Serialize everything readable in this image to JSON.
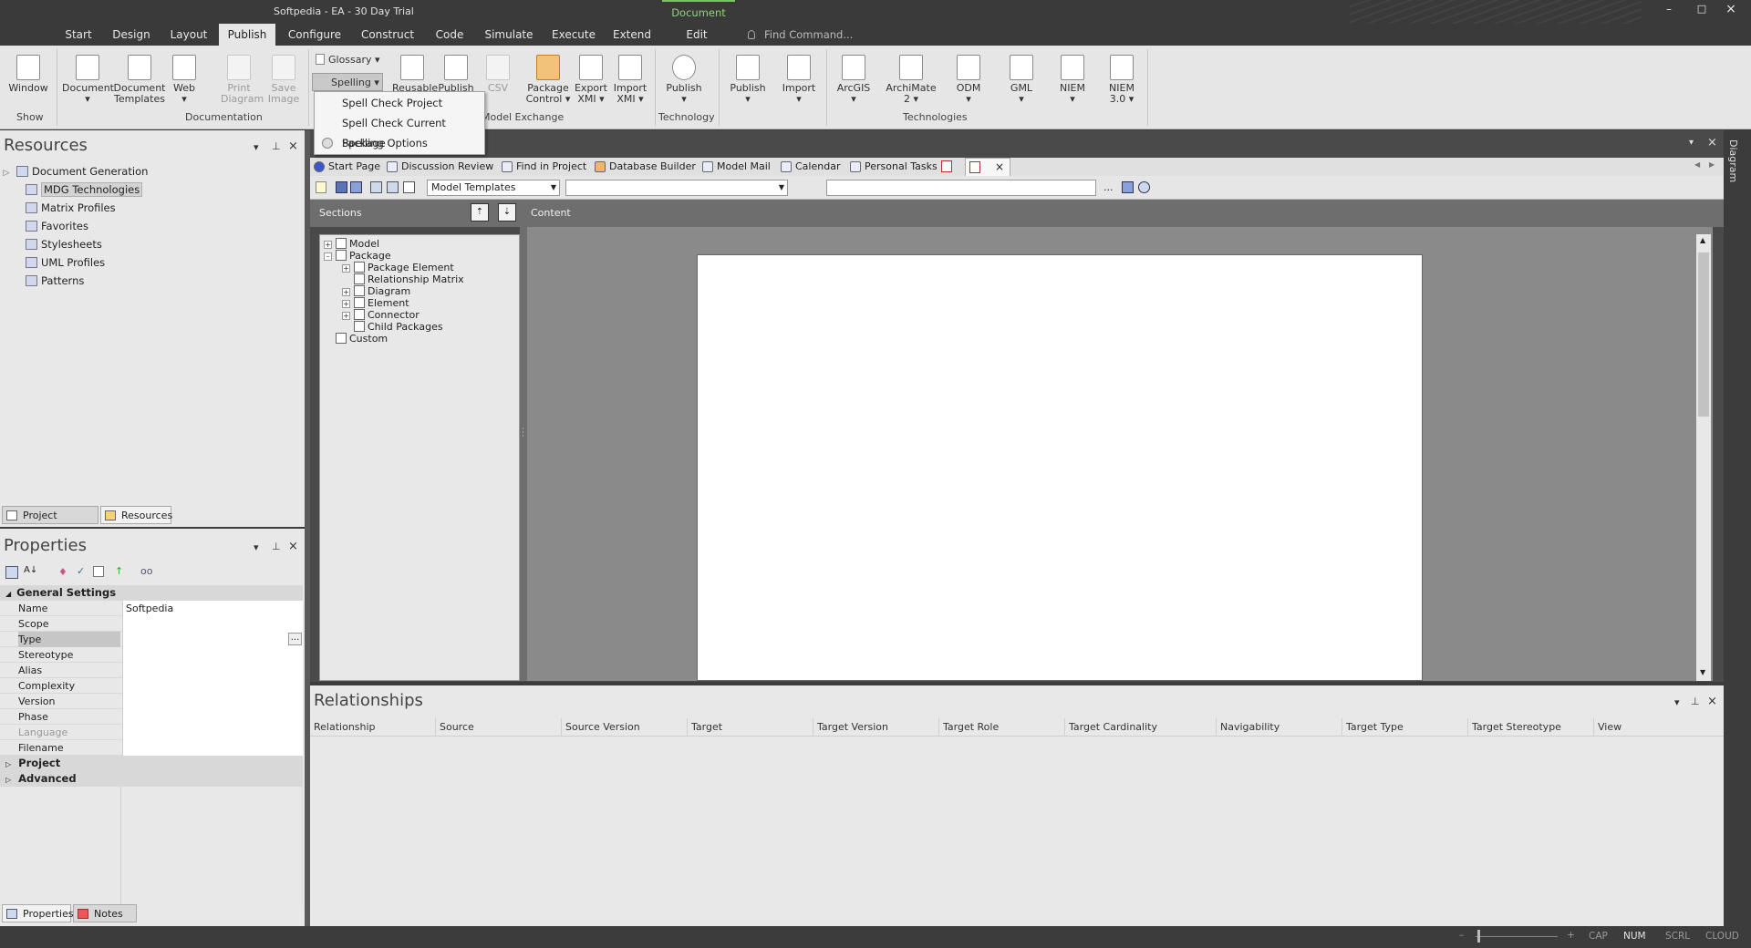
{
  "window": {
    "title": "Softpedia - EA - 30 Day Trial",
    "context_tab_group": "Document",
    "controls": [
      "–",
      "□",
      "×"
    ]
  },
  "menu": {
    "tabs": [
      "Start",
      "Design",
      "Layout",
      "Publish",
      "Configure",
      "Construct",
      "Code",
      "Simulate",
      "Execute",
      "Extend",
      "Edit"
    ],
    "active": "Publish",
    "find_command_placeholder": "Find Command..."
  },
  "ribbon": {
    "show": {
      "window": "Window",
      "group": "Show"
    },
    "documentation": {
      "document": "Document",
      "templates_1": "Document",
      "templates_2": "Templates",
      "web": "Web",
      "print_1": "Print",
      "print_2": "Diagram",
      "save_1": "Save",
      "save_2": "Image",
      "group": "Documentation"
    },
    "glossary": "Glossary",
    "spelling": "Spelling",
    "reusable_1": "Reusable",
    "publish_asset": "Publish",
    "csv": "CSV",
    "package_control_1": "Package",
    "package_control_2": "Control",
    "export_xmi_1": "Export",
    "export_xmi_2": "XMI",
    "import_xmi_1": "Import",
    "import_xmi_2": "XMI",
    "model_exchange": "Model Exchange",
    "publish_tech": "Publish",
    "technology": "Technology",
    "publish2": "Publish",
    "import2": "Import",
    "arcgis": "ArcGIS",
    "archimate_1": "ArchiMate",
    "archimate_2": "2",
    "odm": "ODM",
    "gml": "GML",
    "niem": "NIEM",
    "niem3_1": "NIEM",
    "niem3_2": "3.0",
    "technologies": "Technologies"
  },
  "spelling_menu": {
    "items": [
      "Spell Check Project",
      "Spell Check Current Package",
      "Spelling Options"
    ]
  },
  "resources": {
    "title": "Resources",
    "items": [
      "Document Generation",
      "MDG Technologies",
      "Matrix Profiles",
      "Favorites",
      "Stylesheets",
      "UML Profiles",
      "Patterns"
    ],
    "selected": "MDG Technologies",
    "tabs": [
      "Project Browser",
      "Resources"
    ]
  },
  "properties": {
    "title": "Properties",
    "general_settings": "General Settings",
    "rows": [
      {
        "k": "Name",
        "v": "Softpedia"
      },
      {
        "k": "Scope",
        "v": ""
      },
      {
        "k": "Type",
        "v": ""
      },
      {
        "k": "Stereotype",
        "v": ""
      },
      {
        "k": "Alias",
        "v": ""
      },
      {
        "k": "Complexity",
        "v": ""
      },
      {
        "k": "Version",
        "v": ""
      },
      {
        "k": "Phase",
        "v": ""
      },
      {
        "k": "Language",
        "v": ""
      },
      {
        "k": "Filename",
        "v": ""
      }
    ],
    "project": "Project",
    "advanced": "Advanced",
    "ellipsis": "...",
    "tabs": [
      "Properties",
      "Notes"
    ]
  },
  "doc_tabs": [
    "Start Page",
    "Discussion Review",
    "Find in Project",
    "Database Builder",
    "Model Mail",
    "Calendar",
    "Personal Tasks"
  ],
  "doc_toolbar": {
    "template_combo": "Model Templates",
    "second_combo": "",
    "text_field": "",
    "ellipsis": "..."
  },
  "sections": {
    "header": "Sections",
    "content_header": "Content",
    "tree": [
      "Model",
      "Package",
      "Package Element",
      "Relationship Matrix",
      "Diagram",
      "Element",
      "Connector",
      "Child Packages",
      "Custom"
    ]
  },
  "relationships": {
    "title": "Relationships",
    "columns": [
      "Relationship",
      "Source",
      "Source Version",
      "Target",
      "Target Version",
      "Target Role",
      "Target Cardinality",
      "Navigability",
      "Target Type",
      "Target Stereotype",
      "View"
    ]
  },
  "side_tab": "Diagram",
  "status": {
    "plus": "+",
    "minus": "–",
    "cap": "CAP",
    "num": "NUM",
    "scrl": "SCRL",
    "cloud": "CLOUD"
  }
}
